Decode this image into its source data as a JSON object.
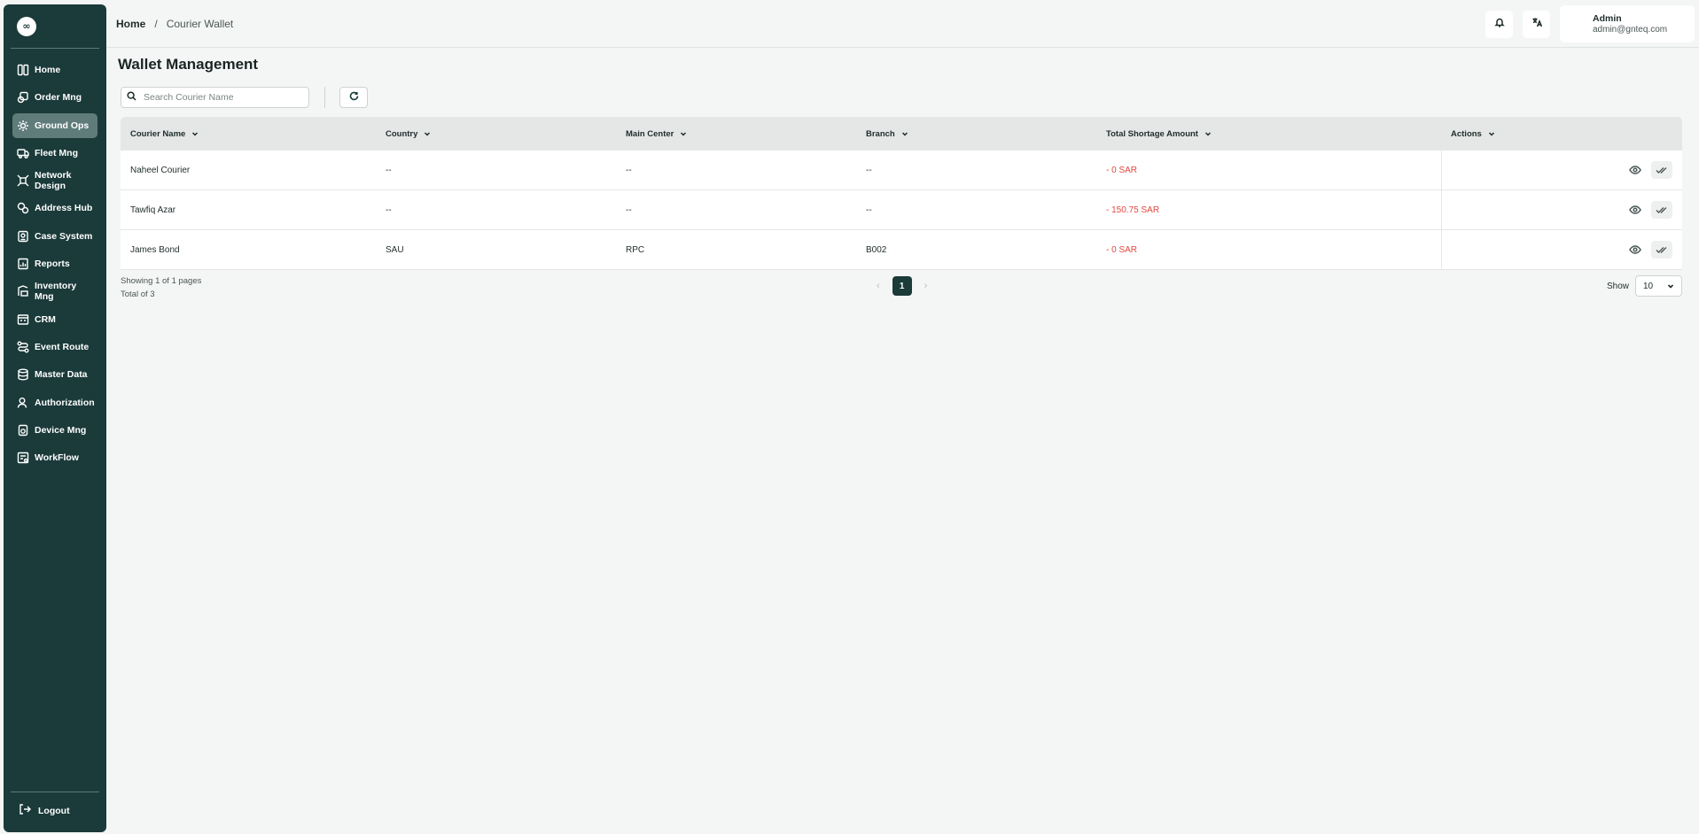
{
  "sidebar": {
    "logo_text": "∞",
    "items": [
      {
        "label": "Home",
        "icon": "home-icon",
        "active": false
      },
      {
        "label": "Order Mng",
        "icon": "order-icon",
        "active": false
      },
      {
        "label": "Ground Ops",
        "icon": "ground-ops-icon",
        "active": true
      },
      {
        "label": "Fleet Mng",
        "icon": "truck-icon",
        "active": false
      },
      {
        "label": "Network Design",
        "icon": "network-icon",
        "active": false
      },
      {
        "label": "Address Hub",
        "icon": "address-icon",
        "active": false
      },
      {
        "label": "Case System",
        "icon": "case-icon",
        "active": false
      },
      {
        "label": "Reports",
        "icon": "reports-icon",
        "active": false
      },
      {
        "label": "Inventory Mng",
        "icon": "inventory-icon",
        "active": false
      },
      {
        "label": "CRM",
        "icon": "crm-icon",
        "active": false
      },
      {
        "label": "Event Route",
        "icon": "route-icon",
        "active": false
      },
      {
        "label": "Master Data",
        "icon": "database-icon",
        "active": false
      },
      {
        "label": "Authorization",
        "icon": "user-icon",
        "active": false
      },
      {
        "label": "Device Mng",
        "icon": "device-icon",
        "active": false
      },
      {
        "label": "WorkFlow",
        "icon": "workflow-icon",
        "active": false
      }
    ],
    "logout_label": "Logout"
  },
  "header": {
    "breadcrumb": {
      "home": "Home",
      "separator": "/",
      "current": "Courier Wallet"
    },
    "user": {
      "name": "Admin",
      "email": "admin@gnteq.com"
    }
  },
  "main": {
    "title": "Wallet Management",
    "search": {
      "placeholder": "Search Courier Name",
      "value": ""
    },
    "table": {
      "columns": [
        "Courier Name",
        "Country",
        "Main Center",
        "Branch",
        "Total Shortage Amount",
        "Actions"
      ],
      "rows": [
        {
          "courier": "Naheel Courier",
          "country": "--",
          "main_center": "--",
          "branch": "--",
          "shortage": "- 0 SAR"
        },
        {
          "courier": "Tawfiq Azar",
          "country": "--",
          "main_center": "--",
          "branch": "--",
          "shortage": "- 150.75 SAR"
        },
        {
          "courier": "James Bond",
          "country": "SAU",
          "main_center": "RPC",
          "branch": "B002",
          "shortage": "- 0 SAR"
        }
      ]
    },
    "pagination": {
      "showing": "Showing 1 of 1 pages",
      "total": "Total of 3",
      "prev": "‹",
      "next": "›",
      "current_page": "1",
      "show_label": "Show",
      "page_size": "10"
    }
  },
  "colors": {
    "sidebar_bg": "#1b3a3a",
    "active_item": "#5f7c7b",
    "negative_amount": "#e2473f"
  }
}
